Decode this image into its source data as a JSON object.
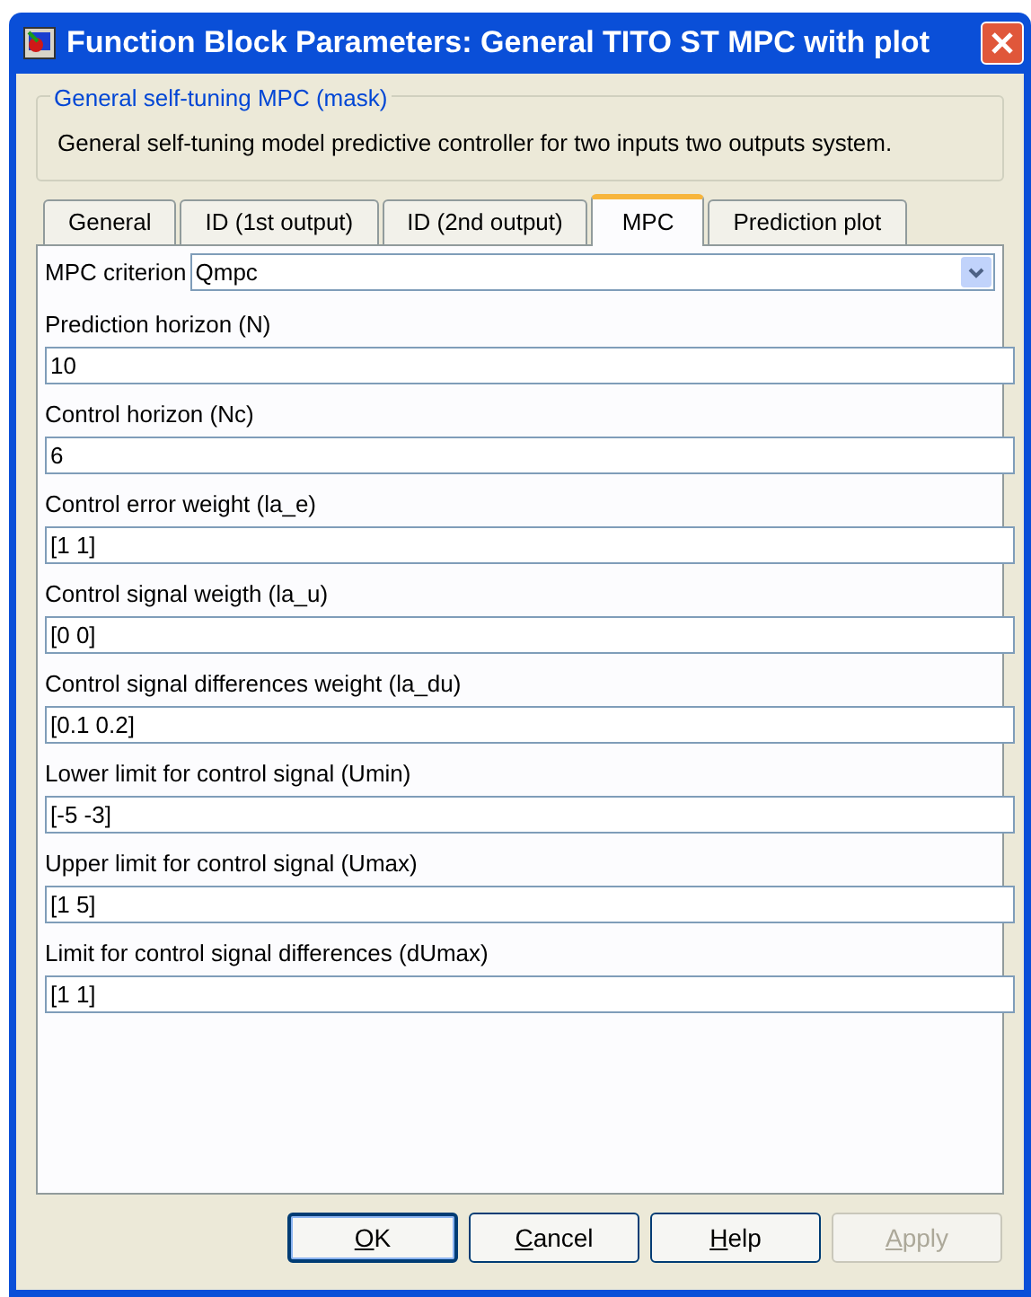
{
  "window": {
    "title": "Function Block Parameters: General TITO ST MPC with plot"
  },
  "group": {
    "title": "General self-tuning MPC (mask)",
    "description": "General self-tuning model predictive controller for two inputs two outputs system."
  },
  "tabs": [
    {
      "label": "General",
      "selected": false
    },
    {
      "label": "ID (1st output)",
      "selected": false
    },
    {
      "label": "ID (2nd output)",
      "selected": false
    },
    {
      "label": "MPC",
      "selected": true
    },
    {
      "label": "Prediction plot",
      "selected": false
    }
  ],
  "fields": [
    {
      "kind": "dropdown",
      "label": "MPC criterion",
      "value": "Qmpc"
    },
    {
      "kind": "text",
      "label": "Prediction horizon (N)",
      "value": "10"
    },
    {
      "kind": "text",
      "label": "Control horizon (Nc)",
      "value": "6"
    },
    {
      "kind": "text",
      "label": "Control error weight (la_e)",
      "value": "[1 1]"
    },
    {
      "kind": "text",
      "label": "Control signal weigth (la_u)",
      "value": "[0 0]"
    },
    {
      "kind": "text",
      "label": "Control signal differences weight (la_du)",
      "value": "[0.1 0.2]"
    },
    {
      "kind": "text",
      "label": "Lower limit for control signal (Umin)",
      "value": "[-5 -3]"
    },
    {
      "kind": "text",
      "label": "Upper limit for control signal (Umax)",
      "value": "[1 5]"
    },
    {
      "kind": "text",
      "label": "Limit for control signal differences (dUmax)",
      "value": "[1 1]"
    }
  ],
  "buttons": [
    {
      "label": "OK",
      "default": true,
      "disabled": false
    },
    {
      "label": "Cancel",
      "default": false,
      "disabled": false
    },
    {
      "label": "Help",
      "default": false,
      "disabled": false
    },
    {
      "label": "Apply",
      "default": false,
      "disabled": true
    }
  ]
}
